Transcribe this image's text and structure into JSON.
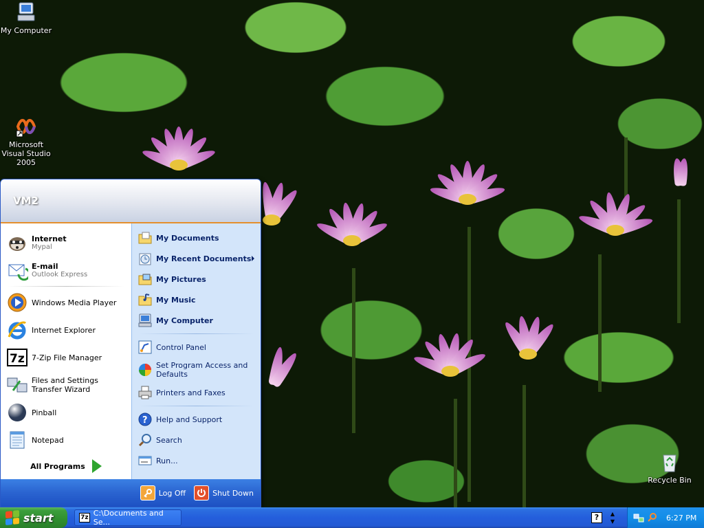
{
  "desktop": {
    "icons": [
      {
        "label": "My Computer",
        "icon": "my-computer-icon"
      },
      {
        "label": "Microsoft Visual Studio 2005",
        "icon": "visual-studio-icon"
      },
      {
        "label": "Recycle Bin",
        "icon": "recycle-bin-icon"
      }
    ]
  },
  "start_menu": {
    "user": "VM2",
    "pinned": [
      {
        "label": "Internet",
        "sub": "Mypal",
        "icon": "raccoon-browser-icon"
      },
      {
        "label": "E-mail",
        "sub": "Outlook Express",
        "icon": "outlook-express-icon"
      }
    ],
    "recent": [
      {
        "label": "Windows Media Player",
        "icon": "media-player-icon"
      },
      {
        "label": "Internet Explorer",
        "icon": "internet-explorer-icon"
      },
      {
        "label": "7-Zip File Manager",
        "icon": "7zip-icon"
      },
      {
        "label": "Files and Settings Transfer Wizard",
        "icon": "transfer-wizard-icon"
      },
      {
        "label": "Pinball",
        "icon": "pinball-icon"
      },
      {
        "label": "Notepad",
        "icon": "notepad-icon"
      }
    ],
    "all_programs": "All Programs",
    "places": [
      {
        "label": "My Documents",
        "icon": "folder-documents-icon"
      },
      {
        "label": "My Recent Documents",
        "icon": "recent-documents-icon"
      },
      {
        "label": "My Pictures",
        "icon": "folder-pictures-icon"
      },
      {
        "label": "My Music",
        "icon": "folder-music-icon"
      },
      {
        "label": "My Computer",
        "icon": "computer-icon"
      }
    ],
    "system": [
      {
        "label": "Control Panel",
        "icon": "control-panel-icon"
      },
      {
        "label": "Set Program Access and Defaults",
        "icon": "program-access-icon"
      },
      {
        "label": "Printers and Faxes",
        "icon": "printer-icon"
      }
    ],
    "tools": [
      {
        "label": "Help and Support",
        "icon": "help-icon"
      },
      {
        "label": "Search",
        "icon": "search-icon"
      },
      {
        "label": "Run...",
        "icon": "run-icon"
      }
    ],
    "log_off": "Log Off",
    "shut_down": "Shut Down"
  },
  "taskbar": {
    "start_label": "start",
    "window_button": "C:\\Documents and Se...",
    "window_icon_text": "7z",
    "help_glyph": "?",
    "clock": "6:27 PM"
  },
  "colors": {
    "taskbar_blue": "#245edc",
    "start_green": "#2f8f2f",
    "tray_blue": "#138ee8",
    "menu_right_bg": "#d3e5fa",
    "menu_accent_orange": "#e58f2c"
  }
}
